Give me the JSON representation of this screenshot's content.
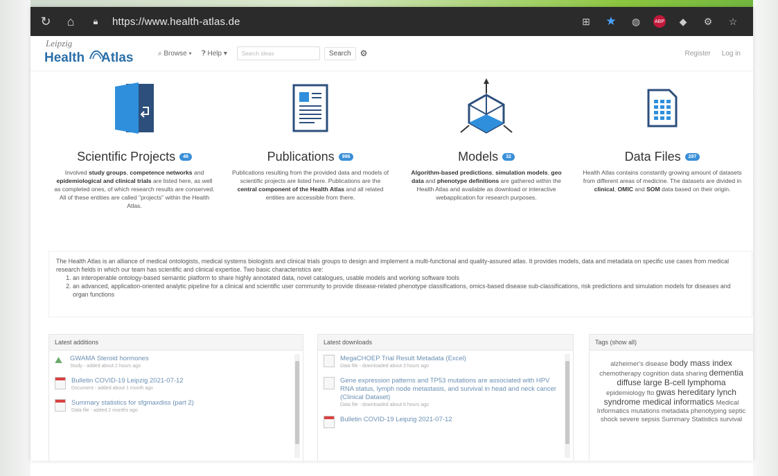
{
  "browser": {
    "url": "https://www.health-atlas.de"
  },
  "nav": {
    "logo_leipzig": "Leipzig",
    "logo_health": "Health",
    "logo_atlas": "Atlas",
    "browse": "Browse ▾",
    "help": "Help ▾",
    "search_placeholder": "Search ideas",
    "search_button": "Search",
    "register": "Register",
    "login": "Log in"
  },
  "features": [
    {
      "title": "Scientific Projects",
      "badge": "48",
      "desc_html": "Involved <b>study groups</b>, <b>competence networks</b> and <b>epidemiological and clinical trials</b> are listed here, as well as completed ones, of which research results are conserved. All of these entities are called \"projects\" within the Health Atlas."
    },
    {
      "title": "Publications",
      "badge": "996",
      "desc_html": "Publications resulting from the provided data and models of scientific projects are listed here. Publications are the <b>central component of the Health Atlas</b> and all related entities are accessible from there."
    },
    {
      "title": "Models",
      "badge": "32",
      "desc_html": "<b>Algorithm-based predictions</b>, <b>simulation models</b>, <b>geo data</b> and <b>phenotype definitions</b> are gathered within the Health Atlas and available as download or interactive webapplication for research purposes."
    },
    {
      "title": "Data Files",
      "badge": "287",
      "desc_html": "Health Atlas contains constantly growing amount of datasets from different areas of medicine. The datasets are divided in <b>clinical</b>, <b>OMIC</b> and <b>SOM</b> data based on their origin."
    }
  ],
  "about": {
    "intro": "The Health Atlas is an alliance of medical ontologists, medical systems biologists and clinical trials groups to design and implement a multi-functional and quality-assured atlas. It provides models, data and metadata on specific use cases from medical research fields in which our team has scientific and clinical expertise. Two basic characteristics are:",
    "points": [
      "an interoperable ontology-based semantic platform to share highly annotated data, novel catalogues, usable models and working software tools",
      "an advanced, application-oriented analytic pipeline for a clinical and scientific user community to provide disease-related phenotype classifications, omics-based disease sub-classifications, risk predictions and simulation models for diseases and organ functions"
    ]
  },
  "panels": {
    "latest_additions": {
      "title": "Latest additions",
      "items": [
        {
          "title": "GWAMA Steroid hormones",
          "sub": "Study - added about 2 hours ago"
        },
        {
          "title": "Bulletin COVID-19 Leipzig 2021-07-12",
          "sub": "Document - added about 1 month ago"
        },
        {
          "title": "Summary statistics for sfgmaxdiss (part 2)",
          "sub": "Data file - added 2 months ago"
        }
      ]
    },
    "latest_downloads": {
      "title": "Latest downloads",
      "items": [
        {
          "title": "MegaCHOEP Trial Result Metadata (Excel)",
          "sub": "Data file - downloaded about 3 hours ago"
        },
        {
          "title": "Gene expression patterns and TP53 mutations are associated with HPV RNA status, lymph node metastasis, and survival in head and neck cancer (Clinical Dataset)",
          "sub": "Data file - downloaded about 6 hours ago"
        },
        {
          "title": "Bulletin COVID-19 Leipzig 2021-07-12",
          "sub": ""
        }
      ]
    },
    "tags": {
      "title": "Tags (show all)",
      "list": [
        "alzheimer's disease",
        "body mass index",
        "chemotherapy",
        "cognition",
        "data sharing",
        "dementia",
        "diffuse large B-cell lymphoma",
        "epidemiology",
        "fto",
        "gwas",
        "hereditary lynch syndrome",
        "medical informatics",
        "Medical Informatics",
        "mutations",
        "metadata",
        "phenotyping",
        "septic shock",
        "severe sepsis",
        "Summary Statistics",
        "survival"
      ]
    }
  },
  "colors": {
    "brand_blue": "#2a6fa8",
    "badge_blue": "#3a8fd8",
    "accent_green": "#8cc63f"
  }
}
